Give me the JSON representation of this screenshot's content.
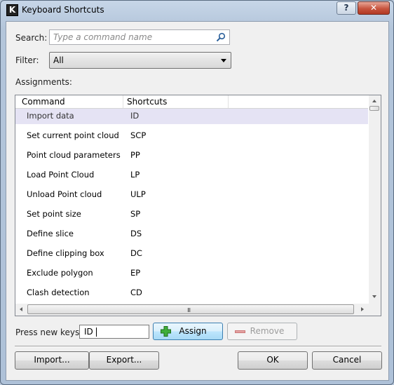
{
  "window": {
    "title": "Keyboard Shortcuts",
    "app_icon_letter": "K",
    "help_label": "?",
    "close_label": "✕"
  },
  "search": {
    "label": "Search:",
    "placeholder": "Type a command name",
    "icon": "search-icon"
  },
  "filter": {
    "label": "Filter:",
    "value": "All"
  },
  "assignments": {
    "label": "Assignments:",
    "columns": [
      "Command",
      "Shortcuts"
    ],
    "rows": [
      {
        "command": "Import data",
        "shortcut": "ID",
        "selected": true
      },
      {
        "command": "Set current point cloud",
        "shortcut": "SCP"
      },
      {
        "command": "Point cloud parameters",
        "shortcut": "PP"
      },
      {
        "command": "Load Point Cloud",
        "shortcut": "LP"
      },
      {
        "command": "Unload Point cloud",
        "shortcut": "ULP"
      },
      {
        "command": "Set point size",
        "shortcut": "SP"
      },
      {
        "command": "Define slice",
        "shortcut": "DS"
      },
      {
        "command": "Define clipping box",
        "shortcut": "DC"
      },
      {
        "command": "Exclude polygon",
        "shortcut": "EP"
      },
      {
        "command": "Clash detection",
        "shortcut": "CD"
      }
    ],
    "hscroll_grip": "III"
  },
  "keys": {
    "label": "Press new keys:",
    "value": "ID"
  },
  "buttons": {
    "assign": "Assign",
    "remove": "Remove",
    "import": "Import...",
    "export": "Export...",
    "ok": "OK",
    "cancel": "Cancel"
  },
  "colors": {
    "selection": "#e5e3f4",
    "assign_accent": "#3c7fb1",
    "close_red": "#c7543e"
  }
}
